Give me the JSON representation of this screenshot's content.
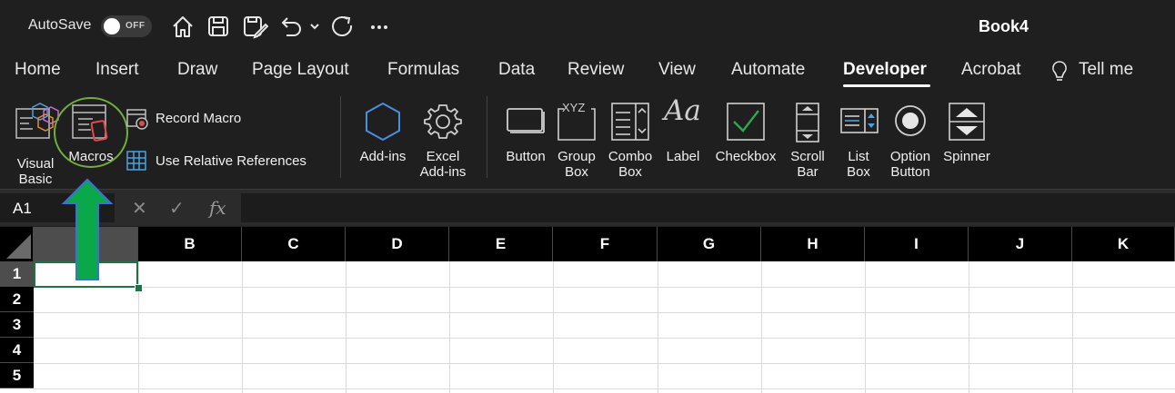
{
  "titlebar": {
    "autosave_label": "AutoSave",
    "autosave_state": "OFF",
    "book_title": "Book4",
    "quick_icons": [
      "home-icon",
      "save-icon",
      "save-as-icon",
      "undo-icon",
      "undo-dropdown-icon",
      "redo-icon",
      "more-icon"
    ]
  },
  "tabs": [
    "Home",
    "Insert",
    "Draw",
    "Page Layout",
    "Formulas",
    "Data",
    "Review",
    "View",
    "Automate",
    "Developer",
    "Acrobat",
    "Tell me"
  ],
  "active_tab": "Developer",
  "ribbon": {
    "visual_basic": [
      "Visual",
      "Basic"
    ],
    "macros": "Macros",
    "record_macro": "Record Macro",
    "use_relative_refs": "Use Relative References",
    "addins": "Add-ins",
    "excel_addins": [
      "Excel",
      "Add-ins"
    ],
    "button": "Button",
    "group_box": [
      "Group",
      "Box"
    ],
    "combo_box": [
      "Combo",
      "Box"
    ],
    "label": "Label",
    "checkbox": "Checkbox",
    "scroll_bar": [
      "Scroll",
      "Bar"
    ],
    "list_box": [
      "List",
      "Box"
    ],
    "option_button": [
      "Option",
      "Button"
    ],
    "spinner": "Spinner",
    "groupbox_glyph": "XYZ",
    "label_glyph": "Aa"
  },
  "formula_bar": {
    "name_box": "A1",
    "cancel_symbol": "✕",
    "enter_symbol": "✓",
    "fx_symbol": "fx",
    "value": ""
  },
  "sheet": {
    "columns": [
      "",
      "B",
      "C",
      "D",
      "E",
      "F",
      "G",
      "H",
      "I",
      "J",
      "K"
    ],
    "rows": [
      "1",
      "2",
      "3",
      "4",
      "5"
    ],
    "active_cell": "A1"
  },
  "colors": {
    "background": "#1f1f1f",
    "active_cell_border": "#1f7244",
    "highlight_circle": "#6fb03c",
    "arrow_fill": "#0aa84a",
    "arrow_stroke": "#3f6fd8"
  }
}
